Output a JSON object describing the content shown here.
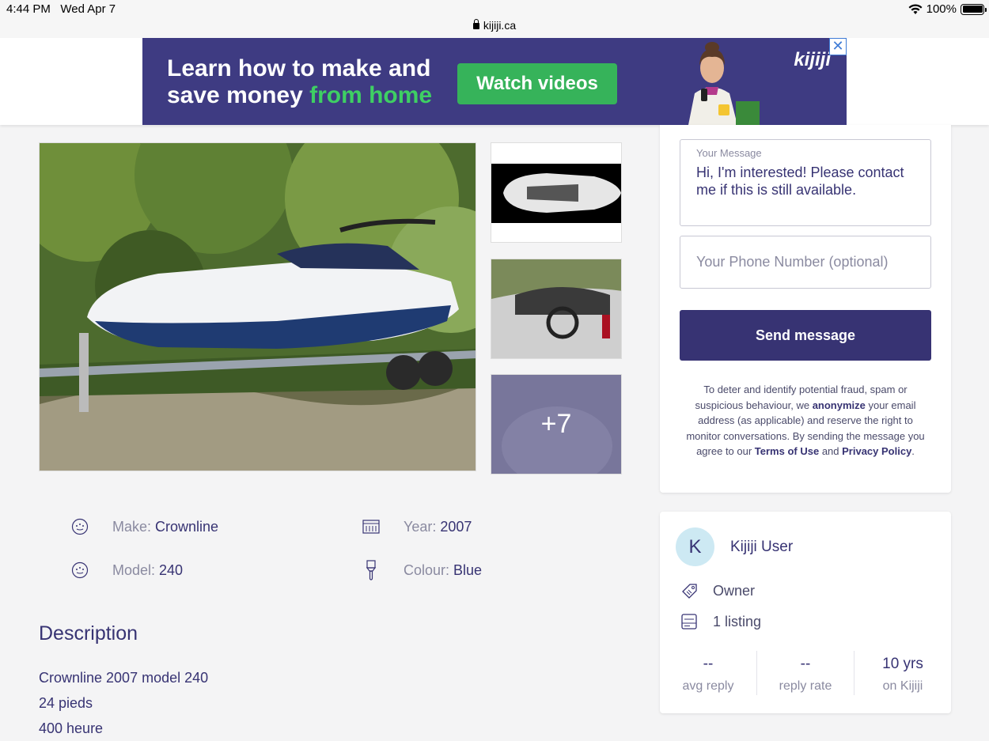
{
  "status_bar": {
    "time": "4:44 PM",
    "date": "Wed Apr 7",
    "url": "kijiji.ca",
    "battery": "100%"
  },
  "ad": {
    "headline_line1": "Learn how to make and",
    "headline_line2_a": "save money ",
    "headline_line2_b": "from home",
    "cta": "Watch videos",
    "logo": "kijiji",
    "close": "✕"
  },
  "gallery": {
    "more_count": "+7"
  },
  "attributes": [
    {
      "key": "Make:",
      "value": "Crownline",
      "icon": "circle-dots-icon"
    },
    {
      "key": "Year:",
      "value": "2007",
      "icon": "calendar-icon"
    },
    {
      "key": "Model:",
      "value": "240",
      "icon": "circle-dots-icon"
    },
    {
      "key": "Colour:",
      "value": "Blue",
      "icon": "paintbrush-icon"
    }
  ],
  "description": {
    "title": "Description",
    "lines": [
      "Crownline 2007 model 240",
      "24 pieds",
      "400 heure"
    ]
  },
  "reply_form": {
    "message_label": "Your Message",
    "message_text": "Hi, I'm interested! Please contact me if this is still available.",
    "phone_placeholder": "Your Phone Number (optional)",
    "send_label": "Send message",
    "legal_1": "To deter and identify potential fraud, spam or suspicious behaviour, we ",
    "legal_bold_1": "anonymize",
    "legal_2": " your email address (as applicable) and reserve the right to monitor conversations. By sending the message you agree to our ",
    "legal_terms": "Terms of Use",
    "legal_3": " and ",
    "legal_privacy": "Privacy Policy",
    "legal_4": "."
  },
  "seller": {
    "initial": "K",
    "name": "Kijiji User",
    "type": "Owner",
    "listings": "1 listing",
    "stats": [
      {
        "value": "--",
        "label": "avg reply"
      },
      {
        "value": "--",
        "label": "reply rate"
      },
      {
        "value": "10 yrs",
        "label": "on Kijiji"
      }
    ]
  },
  "colors": {
    "brand": "#373373",
    "ad_bg": "#3e3b82",
    "cta_green": "#36b35a",
    "avatar_bg": "#cde9f3"
  }
}
